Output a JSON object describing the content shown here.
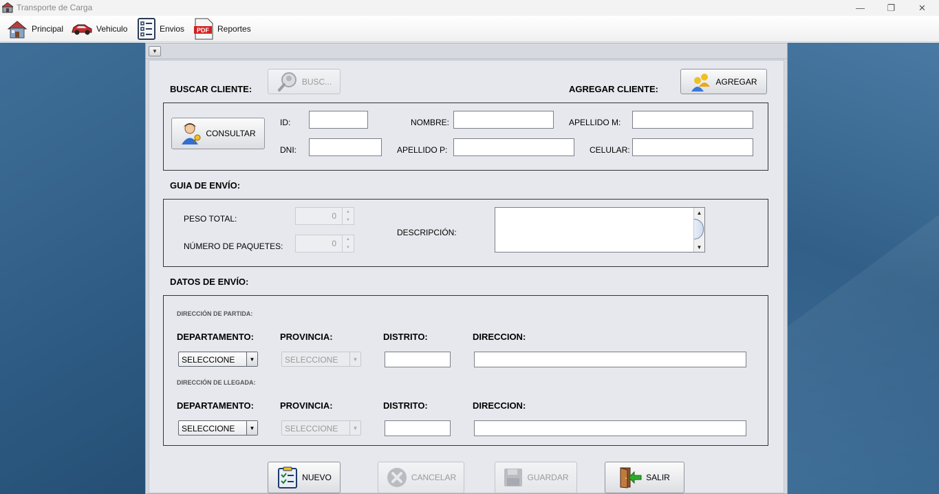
{
  "window": {
    "title": "Transporte de Carga",
    "controls": [
      "—",
      "❐",
      "✕"
    ]
  },
  "menu": {
    "items": [
      {
        "label": "Principal",
        "icon": "house-icon"
      },
      {
        "label": "Vehiculo",
        "icon": "car-icon"
      },
      {
        "label": "Envios",
        "icon": "checklist-icon"
      },
      {
        "label": "Reportes",
        "icon": "pdf-icon"
      }
    ]
  },
  "frame": {
    "collapse_glyph": "▼"
  },
  "cliente": {
    "buscar_label": "BUSCAR CLIENTE:",
    "buscar_button": "BUSC...",
    "agregar_label": "AGREGAR CLIENTE:",
    "agregar_button": "AGREGAR",
    "consultar_button": "CONSULTAR",
    "fields": {
      "id_label": "ID:",
      "dni_label": "DNI:",
      "nombre_label": "NOMBRE:",
      "apellido_p_label": "APELLIDO P:",
      "apellido_m_label": "APELLIDO M:",
      "celular_label": "CELULAR:",
      "id_value": "",
      "dni_value": "",
      "nombre_value": "",
      "apellido_p_value": "",
      "apellido_m_value": "",
      "celular_value": ""
    }
  },
  "guia": {
    "section_label": "GUIA DE ENVÍO:",
    "peso_label": "PESO TOTAL:",
    "peso_value": "0",
    "paquetes_label": "NÚMERO DE PAQUETES:",
    "paquetes_value": "0",
    "descripcion_label": "DESCRIPCIÓN:",
    "descripcion_value": "",
    "scroll_up": "▲",
    "scroll_down": "▼",
    "spin_up": "▲",
    "spin_down": "▼"
  },
  "datos": {
    "section_label": "DATOS DE ENVÍO:",
    "partida": {
      "heading": "DIRECCIÓN DE PARTIDA:",
      "departamento_label": "DEPARTAMENTO:",
      "provincia_label": "PROVINCIA:",
      "distrito_label": "DISTRITO:",
      "direccion_label": "DIRECCION:",
      "departamento_value": "SELECCIONE",
      "provincia_value": "SELECCIONE",
      "distrito_value": "",
      "direccion_value": ""
    },
    "llegada": {
      "heading": "DIRECCIÓN DE LLEGADA:",
      "departamento_label": "DEPARTAMENTO:",
      "provincia_label": "PROVINCIA:",
      "distrito_label": "DISTRITO:",
      "direccion_label": "DIRECCION:",
      "departamento_value": "SELECCIONE",
      "provincia_value": "SELECCIONE",
      "distrito_value": "",
      "direccion_value": ""
    },
    "combo_arrow": "▼"
  },
  "actions": {
    "nuevo": "NUEVO",
    "cancelar": "CANCELAR",
    "guardar": "GUARDAR",
    "salir": "SALIR"
  }
}
